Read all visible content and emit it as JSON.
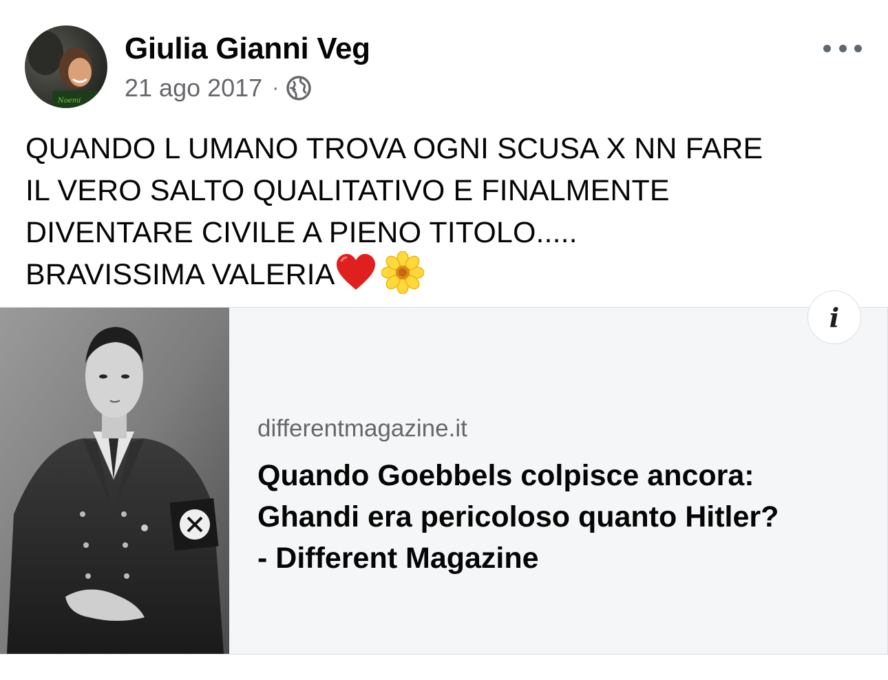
{
  "post": {
    "author": {
      "name": "Giulia Gianni Veg",
      "avatar_icon": "profile-photo"
    },
    "date": "21 ago 2017",
    "separator": "·",
    "audience_icon": "globe-icon",
    "more_icon": "more-options-icon",
    "text_lines": [
      "QUANDO L UMANO TROVA OGNI SCUSA X NN FARE",
      "IL VERO SALTO QUALITATIVO E FINALMENTE",
      "DIVENTARE CIVILE A PIENO TITOLO.....",
      "BRAVISSIMA VALERIA"
    ],
    "emojis": [
      "red-heart",
      "blossom-flower"
    ]
  },
  "link_preview": {
    "domain": "differentmagazine.it",
    "title_lines": [
      "Quando Goebbels colpisce ancora:",
      "Ghandi era pericoloso quanto Hitler?",
      "- Different Magazine"
    ],
    "thumbnail": "black-and-white-portrait-photo",
    "info_label": "i"
  },
  "colors": {
    "text_primary": "#050505",
    "text_secondary": "#65676b",
    "card_background": "#f5f6f8",
    "card_border": "#dadde1",
    "top_separator": "#cfd1d5"
  }
}
